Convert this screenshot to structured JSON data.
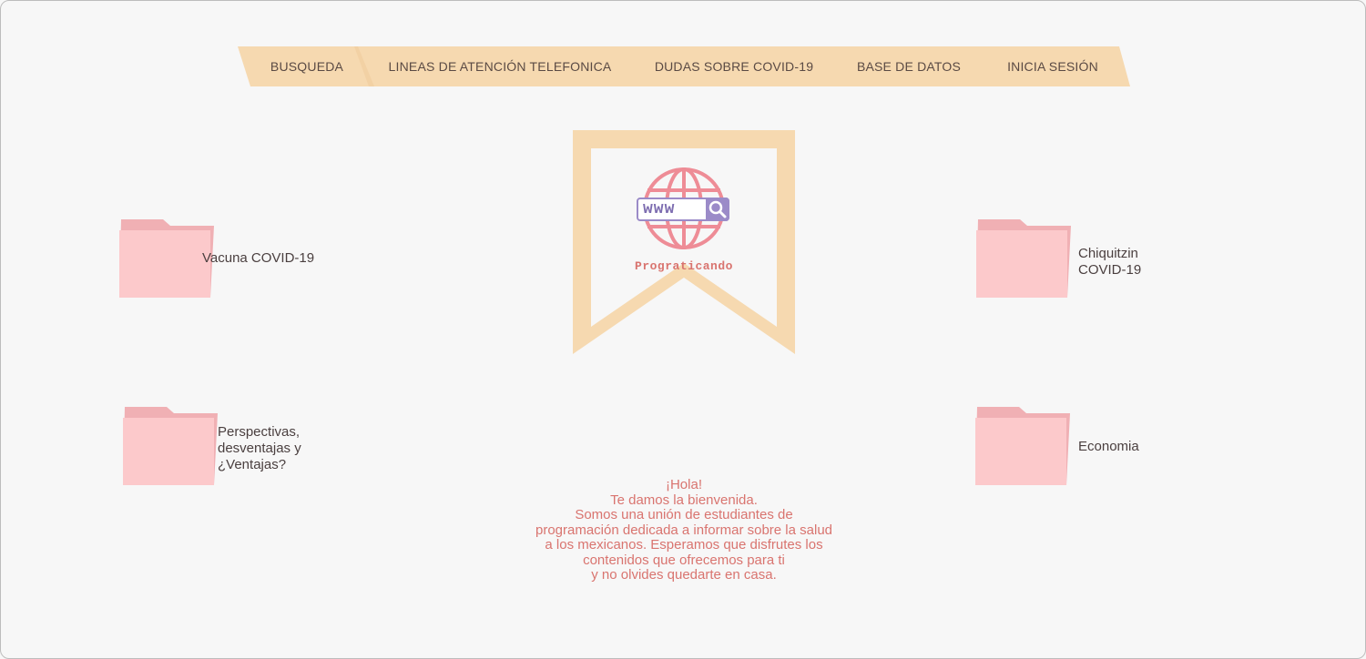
{
  "nav": {
    "items": [
      {
        "label": "BUSQUEDA"
      },
      {
        "label": "LINEAS DE ATENCIÓN TELEFONICA"
      },
      {
        "label": "DUDAS SOBRE COVID-19"
      },
      {
        "label": "BASE DE DATOS"
      },
      {
        "label": "INICIA SESIÓN"
      }
    ]
  },
  "logo": {
    "www_text": "www",
    "brand": "Prograticando"
  },
  "folders": [
    {
      "label": "Vacuna COVID-19"
    },
    {
      "label": "Chiquitzin\nCOVID-19"
    },
    {
      "label": "Perspectivas,\ndesventajas y\n¿Ventajas?"
    },
    {
      "label": "Economia"
    }
  ],
  "welcome": {
    "text": "¡Hola!\nTe damos la bienvenida.\nSomos una unión de estudiantes de\nprogramación dedicada a informar sobre la salud\na los mexicanos. Esperamos que disfrutes los\ncontenidos que ofrecemos para ti\ny no olvides quedarte en casa."
  },
  "colors": {
    "ribbon": "#f6d9b0",
    "folder": "#fcc9cb",
    "brand": "#d9746f",
    "globe": "#ee8c96",
    "search_bar": "#9b8bc8"
  }
}
